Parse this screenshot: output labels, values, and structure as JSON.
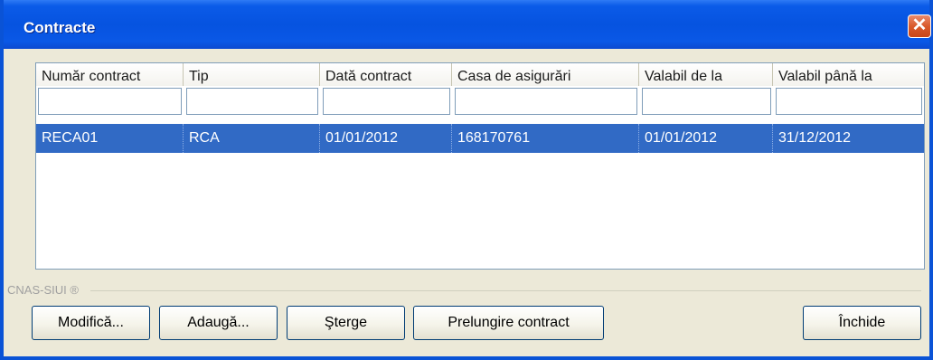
{
  "window": {
    "title": "Contracte",
    "close_glyph": "✕"
  },
  "table": {
    "columns": [
      "Număr contract",
      "Tip",
      "Dată contract",
      "Casa de asigurări",
      "Valabil de la",
      "Valabil până la"
    ],
    "filter_values": [
      "",
      "",
      "",
      "",
      "",
      ""
    ],
    "rows": [
      [
        "RECA01",
        "RCA",
        "01/01/2012",
        "168170761",
        "01/01/2012",
        "31/12/2012"
      ]
    ]
  },
  "group": {
    "label": "CNAS-SIUI ®"
  },
  "buttons": {
    "modify": "Modifică...",
    "add": "Adaugă...",
    "delete": "Şterge",
    "extend": "Prelungire contract",
    "close": "Închide"
  },
  "colors": {
    "title_bar": "#0653e0",
    "selection": "#316ac5",
    "dialog_bg": "#ece9d8",
    "close_button": "#d95a2c"
  }
}
